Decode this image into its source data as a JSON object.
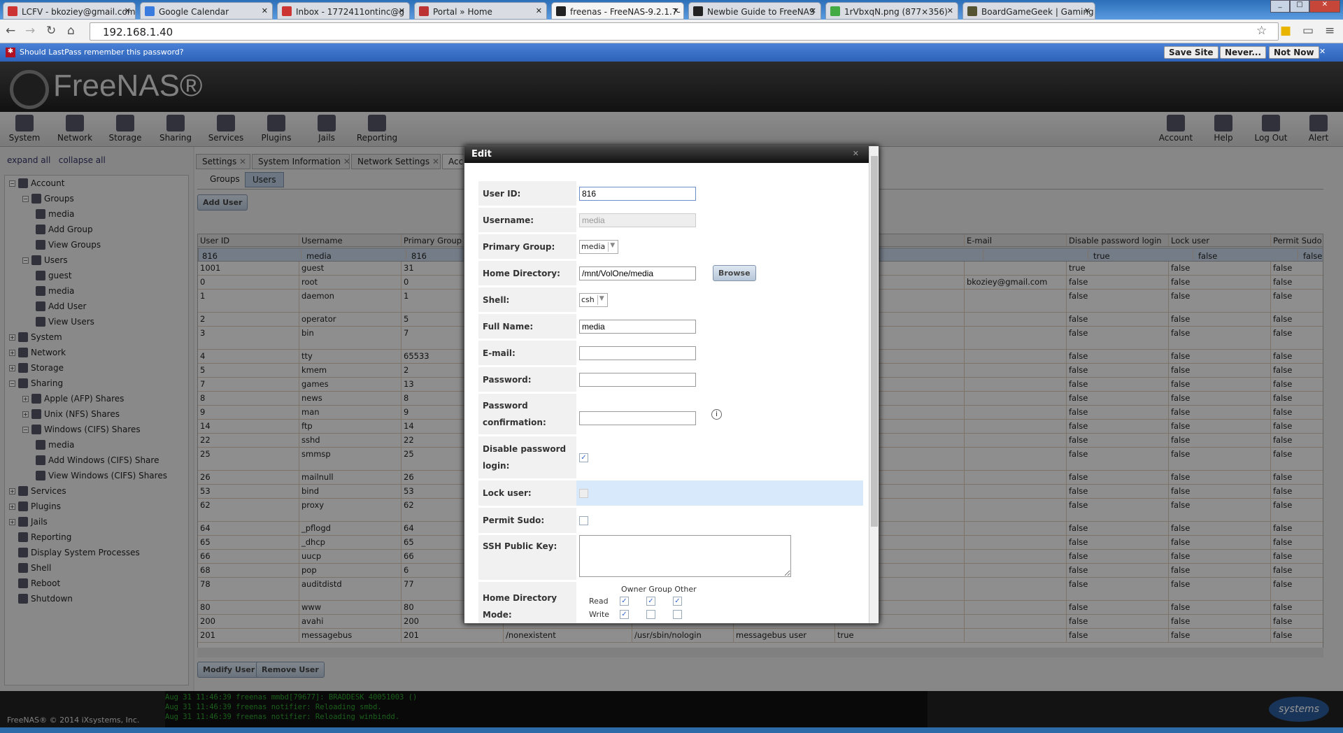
{
  "browser": {
    "tabs": [
      {
        "label": "LCFV - bkoziey@gmail.com",
        "color": "#c33"
      },
      {
        "label": "Google Calendar",
        "color": "#3a7be0"
      },
      {
        "label": "Inbox - 1772411ontinc@g",
        "color": "#c33"
      },
      {
        "label": "Portal » Home",
        "color": "#b33"
      },
      {
        "label": "freenas - FreeNAS-9.2.1.7-",
        "color": "#222",
        "active": true
      },
      {
        "label": "Newbie Guide to FreeNAS",
        "color": "#222"
      },
      {
        "label": "1rVbxqN.png (877×356)",
        "color": "#4a4"
      },
      {
        "label": "BoardGameGeek | Gaming",
        "color": "#553"
      }
    ],
    "url": "192.168.1.40"
  },
  "lastpass": {
    "prompt": "Should LastPass remember this password?",
    "save": "Save Site",
    "never": "Never...",
    "not_now": "Not Now"
  },
  "app": {
    "logo": "FreeNAS®",
    "toolbar_left": [
      "System",
      "Network",
      "Storage",
      "Sharing",
      "Services",
      "Plugins",
      "Jails",
      "Reporting"
    ],
    "toolbar_right": [
      "Account",
      "Help",
      "Log Out",
      "Alert"
    ]
  },
  "sidebar": {
    "expand_all": "expand all",
    "collapse_all": "collapse all",
    "items": [
      {
        "label": "Account",
        "level": 0,
        "toggle": "−"
      },
      {
        "label": "Groups",
        "level": 1,
        "toggle": "−"
      },
      {
        "label": "media",
        "level": 2
      },
      {
        "label": "Add Group",
        "level": 2
      },
      {
        "label": "View Groups",
        "level": 2
      },
      {
        "label": "Users",
        "level": 1,
        "toggle": "−"
      },
      {
        "label": "guest",
        "level": 2
      },
      {
        "label": "media",
        "level": 2
      },
      {
        "label": "Add User",
        "level": 2
      },
      {
        "label": "View Users",
        "level": 2
      },
      {
        "label": "System",
        "level": 0,
        "toggle": "+"
      },
      {
        "label": "Network",
        "level": 0,
        "toggle": "+"
      },
      {
        "label": "Storage",
        "level": 0,
        "toggle": "+"
      },
      {
        "label": "Sharing",
        "level": 0,
        "toggle": "−"
      },
      {
        "label": "Apple (AFP) Shares",
        "level": 1,
        "toggle": "+"
      },
      {
        "label": "Unix (NFS) Shares",
        "level": 1,
        "toggle": "+"
      },
      {
        "label": "Windows (CIFS) Shares",
        "level": 1,
        "toggle": "−"
      },
      {
        "label": "media",
        "level": 2
      },
      {
        "label": "Add Windows (CIFS) Share",
        "level": 2
      },
      {
        "label": "View Windows (CIFS) Shares",
        "level": 2
      },
      {
        "label": "Services",
        "level": 0,
        "toggle": "+"
      },
      {
        "label": "Plugins",
        "level": 0,
        "toggle": "+"
      },
      {
        "label": "Jails",
        "level": 0,
        "toggle": "+"
      },
      {
        "label": "Reporting",
        "level": 0
      },
      {
        "label": "Display System Processes",
        "level": 0
      },
      {
        "label": "Shell",
        "level": 0
      },
      {
        "label": "Reboot",
        "level": 0
      },
      {
        "label": "Shutdown",
        "level": 0
      }
    ]
  },
  "content_tabs": [
    "Settings",
    "System Information",
    "Network Settings",
    "Account"
  ],
  "sub_tabs": [
    "Groups",
    "Users"
  ],
  "add_user": "Add User",
  "table": {
    "columns": [
      "User ID",
      "Username",
      "Primary Group ID",
      "",
      "",
      "",
      "",
      "E-mail",
      "Disable password login",
      "Lock user",
      "Permit Sudo"
    ],
    "rows": [
      [
        "816",
        "media",
        "816",
        "",
        "",
        "",
        "",
        "",
        "true",
        "false",
        "false"
      ],
      [
        "1001",
        "guest",
        "31",
        "",
        "",
        "",
        "",
        "",
        "true",
        "false",
        "false"
      ],
      [
        "0",
        "root",
        "0",
        "",
        "",
        "",
        "",
        "bkoziey@gmail.com",
        "false",
        "false",
        "false"
      ],
      [
        "1",
        "daemon",
        "1",
        "",
        "",
        "",
        "",
        "",
        "false",
        "false",
        "false"
      ],
      [
        "2",
        "operator",
        "5",
        "",
        "",
        "",
        "",
        "",
        "false",
        "false",
        "false"
      ],
      [
        "3",
        "bin",
        "7",
        "",
        "",
        "",
        "",
        "",
        "false",
        "false",
        "false"
      ],
      [
        "4",
        "tty",
        "65533",
        "",
        "",
        "",
        "",
        "",
        "false",
        "false",
        "false"
      ],
      [
        "5",
        "kmem",
        "2",
        "",
        "",
        "",
        "",
        "",
        "false",
        "false",
        "false"
      ],
      [
        "7",
        "games",
        "13",
        "",
        "",
        "",
        "",
        "",
        "false",
        "false",
        "false"
      ],
      [
        "8",
        "news",
        "8",
        "",
        "",
        "",
        "",
        "",
        "false",
        "false",
        "false"
      ],
      [
        "9",
        "man",
        "9",
        "",
        "",
        "",
        "",
        "",
        "false",
        "false",
        "false"
      ],
      [
        "14",
        "ftp",
        "14",
        "",
        "",
        "",
        "",
        "",
        "false",
        "false",
        "false"
      ],
      [
        "22",
        "sshd",
        "22",
        "",
        "",
        "",
        "",
        "",
        "false",
        "false",
        "false"
      ],
      [
        "25",
        "smmsp",
        "25",
        "",
        "",
        "",
        "",
        "",
        "false",
        "false",
        "false"
      ],
      [
        "26",
        "mailnull",
        "26",
        "",
        "",
        "",
        "",
        "",
        "false",
        "false",
        "false"
      ],
      [
        "53",
        "bind",
        "53",
        "",
        "",
        "",
        "",
        "",
        "false",
        "false",
        "false"
      ],
      [
        "62",
        "proxy",
        "62",
        "",
        "",
        "",
        "",
        "",
        "false",
        "false",
        "false"
      ],
      [
        "64",
        "_pflogd",
        "64",
        "",
        "",
        "",
        "",
        "",
        "false",
        "false",
        "false"
      ],
      [
        "65",
        "_dhcp",
        "65",
        "",
        "",
        "",
        "",
        "",
        "false",
        "false",
        "false"
      ],
      [
        "66",
        "uucp",
        "66",
        "",
        "",
        "",
        "",
        "",
        "false",
        "false",
        "false"
      ],
      [
        "68",
        "pop",
        "6",
        "",
        "",
        "",
        "",
        "",
        "false",
        "false",
        "false"
      ],
      [
        "78",
        "auditdistd",
        "77",
        "",
        "",
        "",
        "",
        "",
        "false",
        "false",
        "false"
      ],
      [
        "80",
        "www",
        "80",
        "",
        "",
        "",
        "",
        "",
        "false",
        "false",
        "false"
      ],
      [
        "200",
        "avahi",
        "200",
        "",
        "",
        "",
        "",
        "",
        "false",
        "false",
        "false"
      ],
      [
        "201",
        "messagebus",
        "201",
        "/nonexistent",
        "/usr/sbin/nologin",
        "messagebus user",
        "true",
        "",
        "false",
        "false",
        "false"
      ]
    ]
  },
  "modify_user": "Modify User",
  "remove_user": "Remove User",
  "log": [
    "Aug 31 11:46:39 freenas mmbd[79677]:         BRADDESK 40051003 ()",
    "Aug 31 11:46:39 freenas notifier: Reloading smbd.",
    "Aug 31 11:46:39 freenas notifier: Reloading winbindd."
  ],
  "footer": "FreeNAS® © 2014 iXsystems, Inc.",
  "ix_logo": "iXsystems",
  "modal": {
    "title": "Edit",
    "user_id_label": "User ID:",
    "user_id": "816",
    "username_label": "Username:",
    "username": "media",
    "group_label": "Primary Group:",
    "group": "media",
    "home_label": "Home Directory:",
    "home": "/mnt/VolOne/media",
    "browse": "Browse",
    "shell_label": "Shell:",
    "shell": "csh",
    "fullname_label": "Full Name:",
    "fullname": "media",
    "email_label": "E-mail:",
    "email": "",
    "password_label": "Password:",
    "confirm_label": "Password confirmation:",
    "disable_label": "Disable password login:",
    "disable": true,
    "lock_label": "Lock user:",
    "lock": false,
    "sudo_label": "Permit Sudo:",
    "sudo": false,
    "ssh_label": "SSH Public Key:",
    "ssh": "",
    "mode_label": "Home Directory Mode:",
    "mode_header": "Owner Group Other",
    "read": "Read",
    "write": "Write",
    "mode_read": [
      true,
      true,
      true
    ],
    "mode_write": [
      true,
      false,
      false
    ]
  }
}
